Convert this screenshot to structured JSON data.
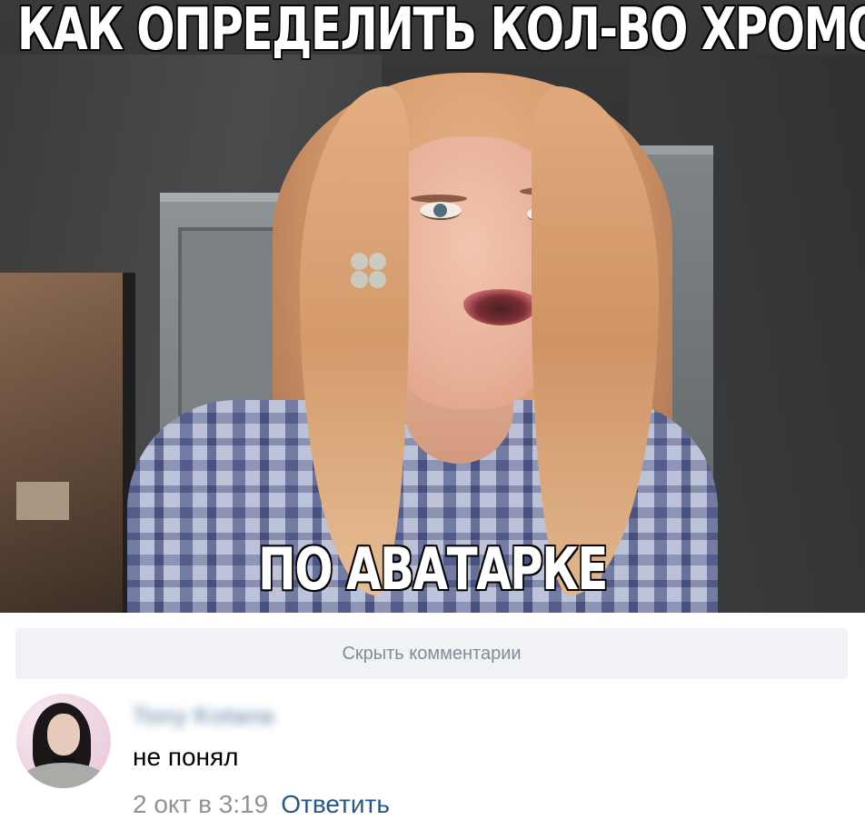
{
  "meme": {
    "top_caption": "КАК ОПРЕДЕЛИТЬ КОЛ-ВО ХРОМОСОМ",
    "bottom_caption": "ПО АВАТАРКЕ"
  },
  "comments": {
    "hide_button_label": "Скрыть комментарии",
    "items": [
      {
        "author": "Tony Kotana",
        "text": "не понял",
        "date": "2 окт в 3:19",
        "reply_label": "Ответить"
      }
    ]
  },
  "colors": {
    "link": "#2a5885",
    "muted": "#939393",
    "button_bg": "#f0f2f5",
    "button_text": "#818c99"
  }
}
